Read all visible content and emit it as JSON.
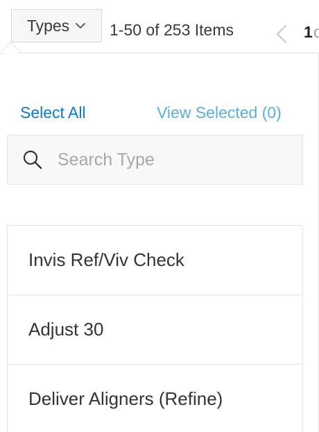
{
  "toolbar": {
    "types_label": "Types",
    "range_text": "1-50 of 253 Items",
    "current_page": "1",
    "page_suffix": "of"
  },
  "dropdown": {
    "select_all_label": "Select All",
    "view_selected_label": "View Selected (0)",
    "search": {
      "placeholder": "Search Type",
      "value": ""
    },
    "items": [
      {
        "label": "Invis Ref/Viv Check"
      },
      {
        "label": "Adjust 30"
      },
      {
        "label": "Deliver Aligners (Refine)"
      }
    ]
  },
  "icons": {
    "chevron": "chevron-down-icon",
    "prev": "chevron-left-icon",
    "search": "search-icon"
  },
  "colors": {
    "link": "#0a7ac4",
    "link_muted": "#5aaede",
    "border": "#e4e4e4"
  }
}
